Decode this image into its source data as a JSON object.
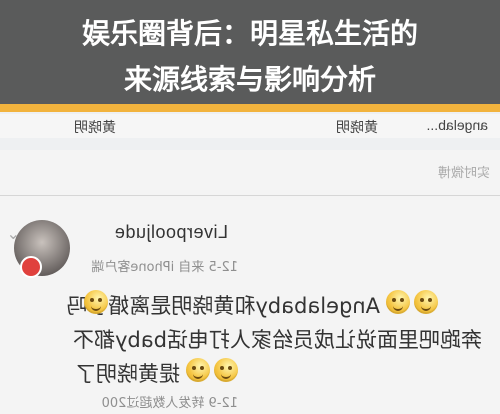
{
  "headline": {
    "line1": "娱乐圈背后：明星私生活的",
    "line2": "来源线索与影响分析"
  },
  "screen": {
    "names_row": [
      "angelab...",
      "黄晓明",
      "黄晓明"
    ],
    "section_label": "实时微博",
    "post": {
      "username": "Liverpooljude",
      "meta": "12-5  来自 iPhone客户端",
      "line1": "Angelababy和黄晓明是离婚了吗",
      "line2": "奔跑吧里面说让成员给家人打电话baby都不",
      "line3": "提黄晓明了",
      "stats": "12-9 转发人数超过200"
    }
  },
  "colors": {
    "overlay": "#464646",
    "accent": "#f2b33d",
    "badge": "#e0413d"
  },
  "icons": {
    "emoji": "grinning-face-icon",
    "badge": "red-badge-icon",
    "chevron": "chevron-down-icon"
  }
}
